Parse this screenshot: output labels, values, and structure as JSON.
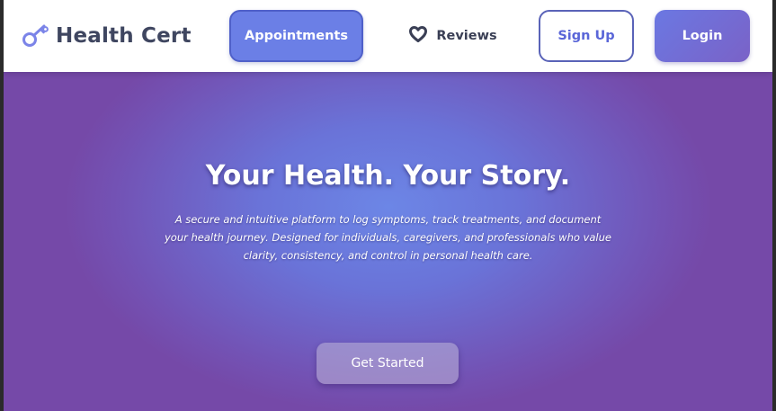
{
  "brand": {
    "name": "Health Cert",
    "icon": "key-icon"
  },
  "nav": {
    "appointments_label": "Appointments",
    "reviews_label": "Reviews",
    "reviews_icon": "heart-icon",
    "signup_label": "Sign Up",
    "login_label": "Login"
  },
  "hero": {
    "title": "Your Health. Your Story.",
    "description": "A secure and intuitive platform to log symptoms, track treatments, and document your health journey. Designed for individuals, caregivers, and professionals who value clarity, consistency, and control in personal health care.",
    "cta_label": "Get Started"
  },
  "colors": {
    "accent": "#6b7fe6",
    "brand_text": "#3f4660",
    "hero_center": "#6c86e6",
    "hero_edge": "#7549a8"
  }
}
